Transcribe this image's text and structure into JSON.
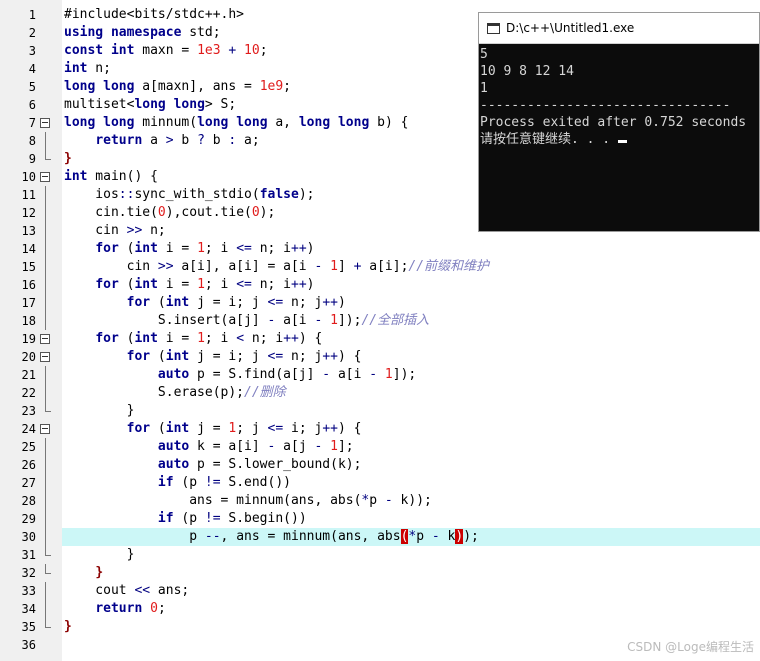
{
  "editor": {
    "lines": [
      {
        "n": "1"
      },
      {
        "n": "2"
      },
      {
        "n": "3"
      },
      {
        "n": "4"
      },
      {
        "n": "5"
      },
      {
        "n": "6"
      },
      {
        "n": "7"
      },
      {
        "n": "8"
      },
      {
        "n": "9"
      },
      {
        "n": "10"
      },
      {
        "n": "11"
      },
      {
        "n": "12"
      },
      {
        "n": "13"
      },
      {
        "n": "14"
      },
      {
        "n": "15"
      },
      {
        "n": "16"
      },
      {
        "n": "17"
      },
      {
        "n": "18"
      },
      {
        "n": "19"
      },
      {
        "n": "20"
      },
      {
        "n": "21"
      },
      {
        "n": "22"
      },
      {
        "n": "23"
      },
      {
        "n": "24"
      },
      {
        "n": "25"
      },
      {
        "n": "26"
      },
      {
        "n": "27"
      },
      {
        "n": "28"
      },
      {
        "n": "29"
      },
      {
        "n": "30"
      },
      {
        "n": "31"
      },
      {
        "n": "32"
      },
      {
        "n": "33"
      },
      {
        "n": "34"
      },
      {
        "n": "35"
      },
      {
        "n": "36"
      }
    ],
    "current_line": "30",
    "current_line_color": "#ccf7f7"
  },
  "console": {
    "title": "D:\\c++\\Untitled1.exe",
    "lines": [
      "5",
      "10 9 8 12 14",
      "1",
      "--------------------------------",
      "Process exited after 0.752 seconds",
      "请按任意键继续. . . "
    ]
  },
  "watermark": "CSDN @Loge编程生活"
}
